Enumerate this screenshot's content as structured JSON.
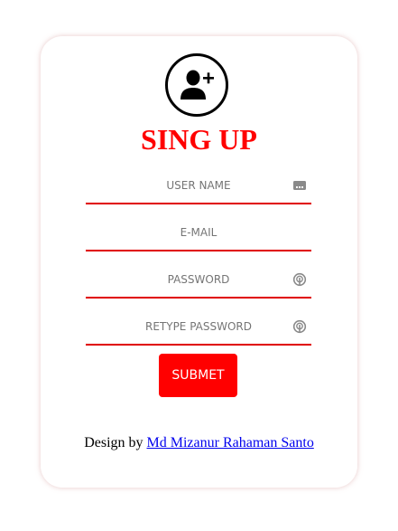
{
  "form": {
    "title": "SING UP",
    "fields": [
      {
        "placeholder": "USER NAME",
        "value": "",
        "icon": "id-card-icon"
      },
      {
        "placeholder": "E-MAIL",
        "value": ""
      },
      {
        "placeholder": "PASSWORD",
        "value": "",
        "icon": "fingerprint-icon"
      },
      {
        "placeholder": "RETYPE PASSWORD",
        "value": "",
        "icon": "fingerprint-icon"
      }
    ],
    "submit_label": "SUBMET"
  },
  "footer": {
    "prefix": "Design by",
    "author_link": "Md Mizanur Rahaman Santo"
  },
  "colors": {
    "accent": "#ff0000",
    "underline": "#e00000",
    "link": "#0000ee",
    "icon_gray": "#8a8a8a"
  }
}
